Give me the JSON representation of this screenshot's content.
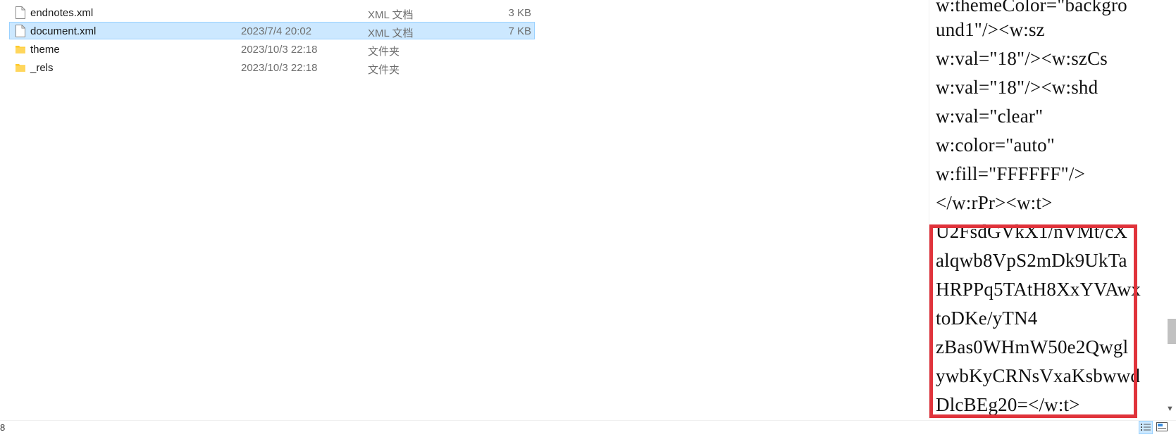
{
  "files": [
    {
      "name": "endnotes.xml",
      "date": "",
      "type": "XML 文档",
      "size": "3 KB",
      "kind": "file",
      "selected": false
    },
    {
      "name": "document.xml",
      "date": "2023/7/4 20:02",
      "type": "XML 文档",
      "size": "7 KB",
      "kind": "file",
      "selected": true
    },
    {
      "name": "theme",
      "date": "2023/10/3 22:18",
      "type": "文件夹",
      "size": "",
      "kind": "folder",
      "selected": false
    },
    {
      "name": "_rels",
      "date": "2023/10/3 22:18",
      "type": "文件夹",
      "size": "",
      "kind": "folder",
      "selected": false
    }
  ],
  "xml_viewer": {
    "lines": [
      "w:themeColor=\"backgro",
      "und1\"/><w:sz",
      "w:val=\"18\"/><w:szCs",
      "w:val=\"18\"/><w:shd",
      "w:val=\"clear\"",
      "w:color=\"auto\"",
      "w:fill=\"FFFFFF\"/>",
      "</w:rPr><w:t>",
      "U2FsdGVkX1/nVMt/cX",
      "alqwb8VpS2mDk9UkTa",
      "HRPPq5TAtH8XxYVAwx",
      "toDKe/yTN4",
      "zBas0WHmW50e2Qwgl",
      "ywbKyCRNsVxaKsbwwd",
      "DlcBEg20=</w:t>"
    ]
  },
  "status_bar": {
    "item_count": "8"
  },
  "colors": {
    "selection_bg": "#cce8ff",
    "selection_border": "#99d1ff",
    "highlight_box": "#e0333b",
    "folder": "#ffca28"
  },
  "icons": {
    "file": "xml-file-icon",
    "folder": "folder-icon",
    "scroll_down": "chevron-down-icon"
  }
}
